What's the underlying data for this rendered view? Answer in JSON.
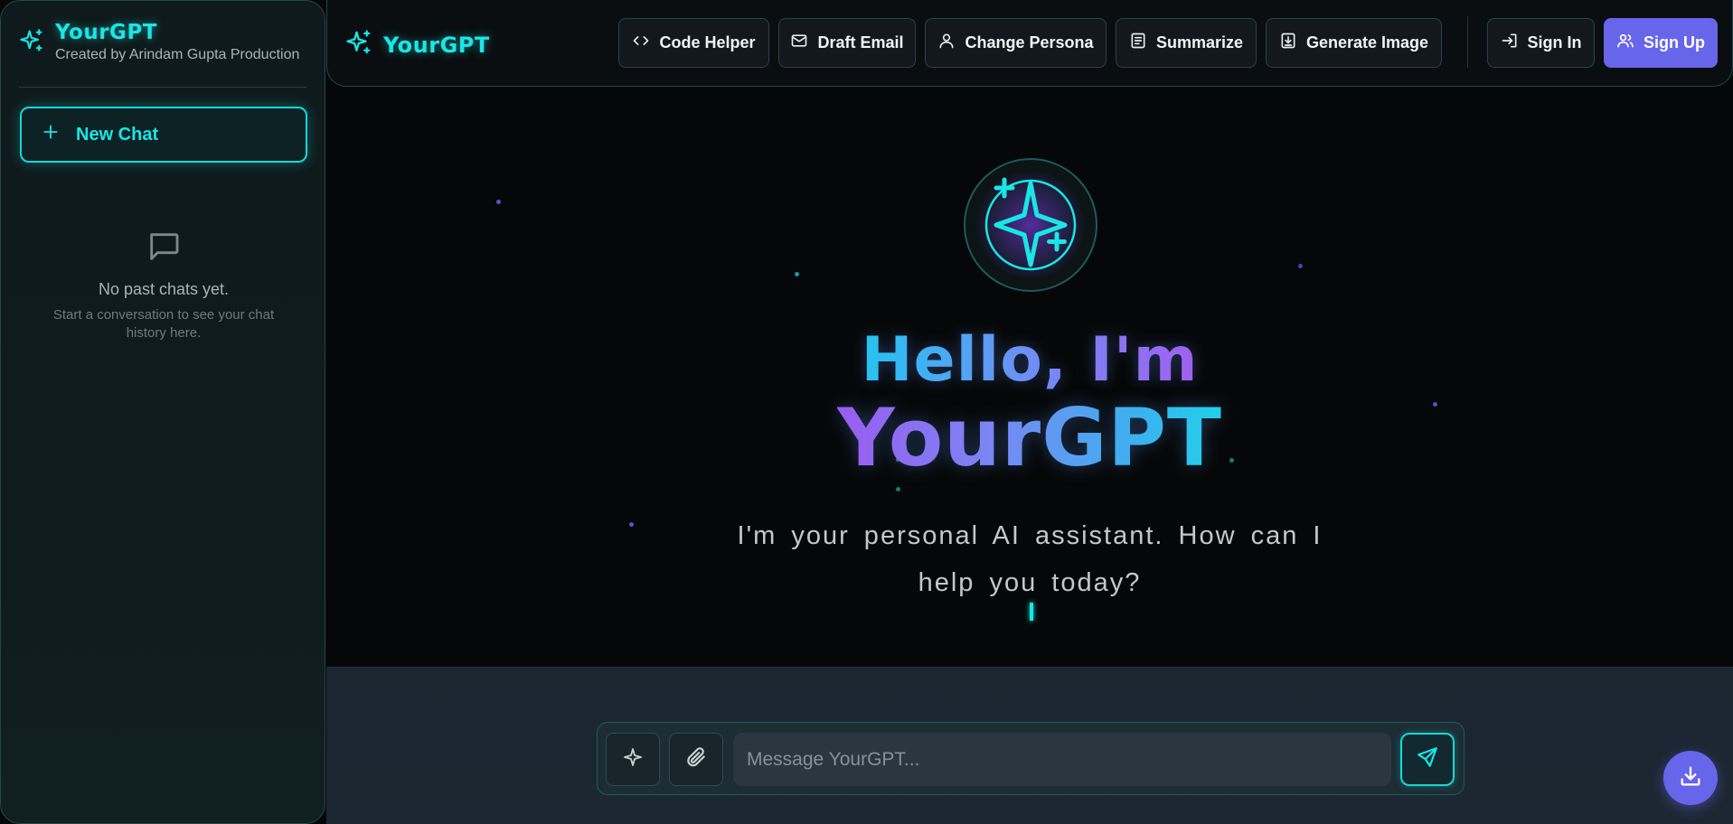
{
  "app": {
    "name": "YourGPT",
    "credit": "Created by Arindam Gupta Production"
  },
  "sidebar": {
    "new_chat_label": "New Chat",
    "empty_title": "No past chats yet.",
    "empty_desc": "Start a conversation to see your chat history here."
  },
  "header": {
    "brand": "YourGPT",
    "actions": [
      {
        "label": "Code Helper",
        "icon": "code-icon"
      },
      {
        "label": "Draft Email",
        "icon": "mail-icon"
      },
      {
        "label": "Change Persona",
        "icon": "user-icon"
      },
      {
        "label": "Summarize",
        "icon": "document-icon"
      },
      {
        "label": "Generate Image",
        "icon": "download-box-icon"
      }
    ],
    "sign_in": "Sign In",
    "sign_up": "Sign Up"
  },
  "hero": {
    "greeting": "Hello, I'm",
    "brand": "YourGPT",
    "tagline": "I'm your personal AI assistant. How can I help you today?"
  },
  "composer": {
    "placeholder": "Message YourGPT...",
    "value": ""
  },
  "colors": {
    "accent": "#19e6e6",
    "primary": "#6765ea",
    "background": "#060708"
  }
}
